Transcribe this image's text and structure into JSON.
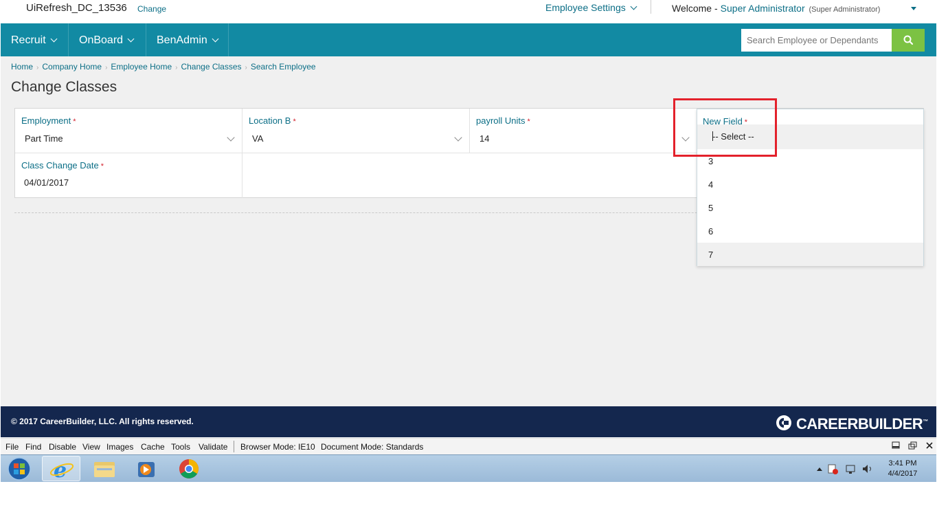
{
  "top": {
    "company": "UiRefresh_DC_13536",
    "change_link": "Change",
    "employee_settings": "Employee Settings",
    "welcome": "Welcome -",
    "user_name": "Super Administrator",
    "user_role": "(Super Administrator)"
  },
  "nav": {
    "items": [
      {
        "label": "Recruit"
      },
      {
        "label": "OnBoard"
      },
      {
        "label": "BenAdmin"
      }
    ],
    "search_placeholder": "Search Employee or Dependants"
  },
  "breadcrumb": [
    "Home",
    "Company Home",
    "Employee Home",
    "Change Classes",
    "Search Employee"
  ],
  "page_title": "Change Classes",
  "form": {
    "employment": {
      "label": "Employment",
      "value": "Part Time"
    },
    "location": {
      "label": "Location B",
      "value": "VA"
    },
    "payroll": {
      "label": "payroll Units",
      "value": "14"
    },
    "new_field": {
      "label": "New Field",
      "value": "-- Select --"
    },
    "class_change_date": {
      "label": "Class Change Date",
      "value": "04/01/2017"
    },
    "required_mark": "*"
  },
  "dropdown": {
    "options": [
      "3",
      "4",
      "5",
      "6",
      "7"
    ],
    "hovered": "7"
  },
  "footer": {
    "copyright": "© 2017 CareerBuilder, LLC. All rights reserved.",
    "brand": "CAREERBUILDER",
    "brand_mark": "™"
  },
  "devtools": {
    "items": [
      "File",
      "Find",
      "Disable",
      "View",
      "Images",
      "Cache",
      "Tools",
      "Validate"
    ],
    "browser_mode": "Browser Mode:  IE10",
    "document_mode": "Document Mode:  Standards"
  },
  "taskbar": {
    "time": "3:41 PM",
    "date": "4/4/2017"
  },
  "colors": {
    "nav": "#128aa3",
    "search_button": "#7cc243",
    "footer": "#14274e",
    "highlight": "#e3212b",
    "link": "#0b6e86"
  }
}
